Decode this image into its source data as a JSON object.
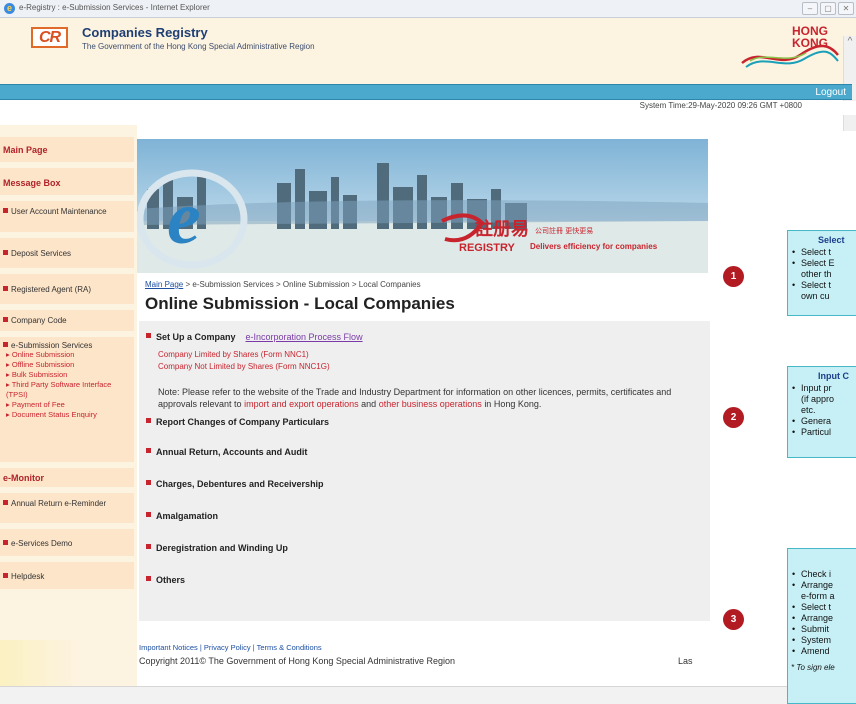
{
  "browser": {
    "title": "e-Registry : e-Submission Services - Internet Explorer"
  },
  "header": {
    "logo_text": "CR",
    "title": "Companies Registry",
    "subtitle": "The Government of the Hong Kong Special Administrative Region",
    "brand": "HONG KONG"
  },
  "topbar": {
    "logout": "Logout",
    "system_time": "System Time:29-May-2020 09:26 GMT +0800"
  },
  "nav": {
    "main_page": "Main Page",
    "message_box": "Message Box",
    "user_account": "User Account Maintenance",
    "deposit": "Deposit Services",
    "registered_agent": "Registered Agent (RA)",
    "company_code": "Company Code",
    "esub": "e-Submission Services",
    "esub_items": [
      "Online Submission",
      "Offline Submission",
      "Bulk Submission",
      "Third Party Software Interface (TPSI)",
      "Payment of Fee",
      "Document Status Enquiry"
    ],
    "emonitor": "e-Monitor",
    "annual_return": "Annual Return e-Reminder",
    "eservices_demo": "e-Services Demo",
    "helpdesk": "Helpdesk"
  },
  "banner": {
    "ereg_cn": "註册易",
    "ereg_en": "REGISTRY",
    "slogan_cn": "公司註冊 更快更易",
    "slogan_en": "Delivers efficiency for companies"
  },
  "breadcrumb": {
    "main": "Main Page",
    "b2": "e-Submission Services",
    "b3": "Online Submission",
    "b4": "Local Companies",
    "sep": ">"
  },
  "page": {
    "title": "Online Submission - Local Companies"
  },
  "sections": {
    "setup": "Set Up a Company",
    "einc_link": "e-Incorporation Process Flow",
    "form1": "Company Limited by Shares (Form NNC1)",
    "form2": "Company Not Limited by Shares (Form NNC1G)",
    "note_a": "Note: Please refer to the website of the Trade and Industry Department for information on other licences, permits, certificates and approvals relevant to",
    "note_link1": "import and export operations",
    "note_and": "and",
    "note_link2": "other business operations",
    "note_b": "in Hong Kong.",
    "report": "Report Changes of Company Particulars",
    "annual": "Annual Return, Accounts and Audit",
    "charges": "Charges, Debentures and Receivership",
    "amalg": "Amalgamation",
    "dereg": "Deregistration and Winding Up",
    "others": "Others"
  },
  "footer": {
    "notices": "Important Notices",
    "privacy": "Privacy Policy",
    "terms": "Terms & Conditions",
    "sep": "|",
    "copyright": "Copyright 2011© The Government of Hong Kong Special Administrative Region",
    "las": "Las"
  },
  "callouts": {
    "n1": "1",
    "n2": "2",
    "n3": "3",
    "c1_head": "Select",
    "c1_items": [
      "Select t",
      "Select E",
      "other th",
      "Select t",
      "own cu"
    ],
    "c2_head": "Input C",
    "c2_items": [
      "Input pr",
      "(if appro",
      "etc.",
      "Genera",
      "Particul"
    ],
    "c3_items": [
      "Check i",
      "Arrange",
      "e-form a",
      "Select t",
      "Arrange",
      "Submit",
      "System",
      "Amend"
    ],
    "foot": "* To sign ele"
  }
}
